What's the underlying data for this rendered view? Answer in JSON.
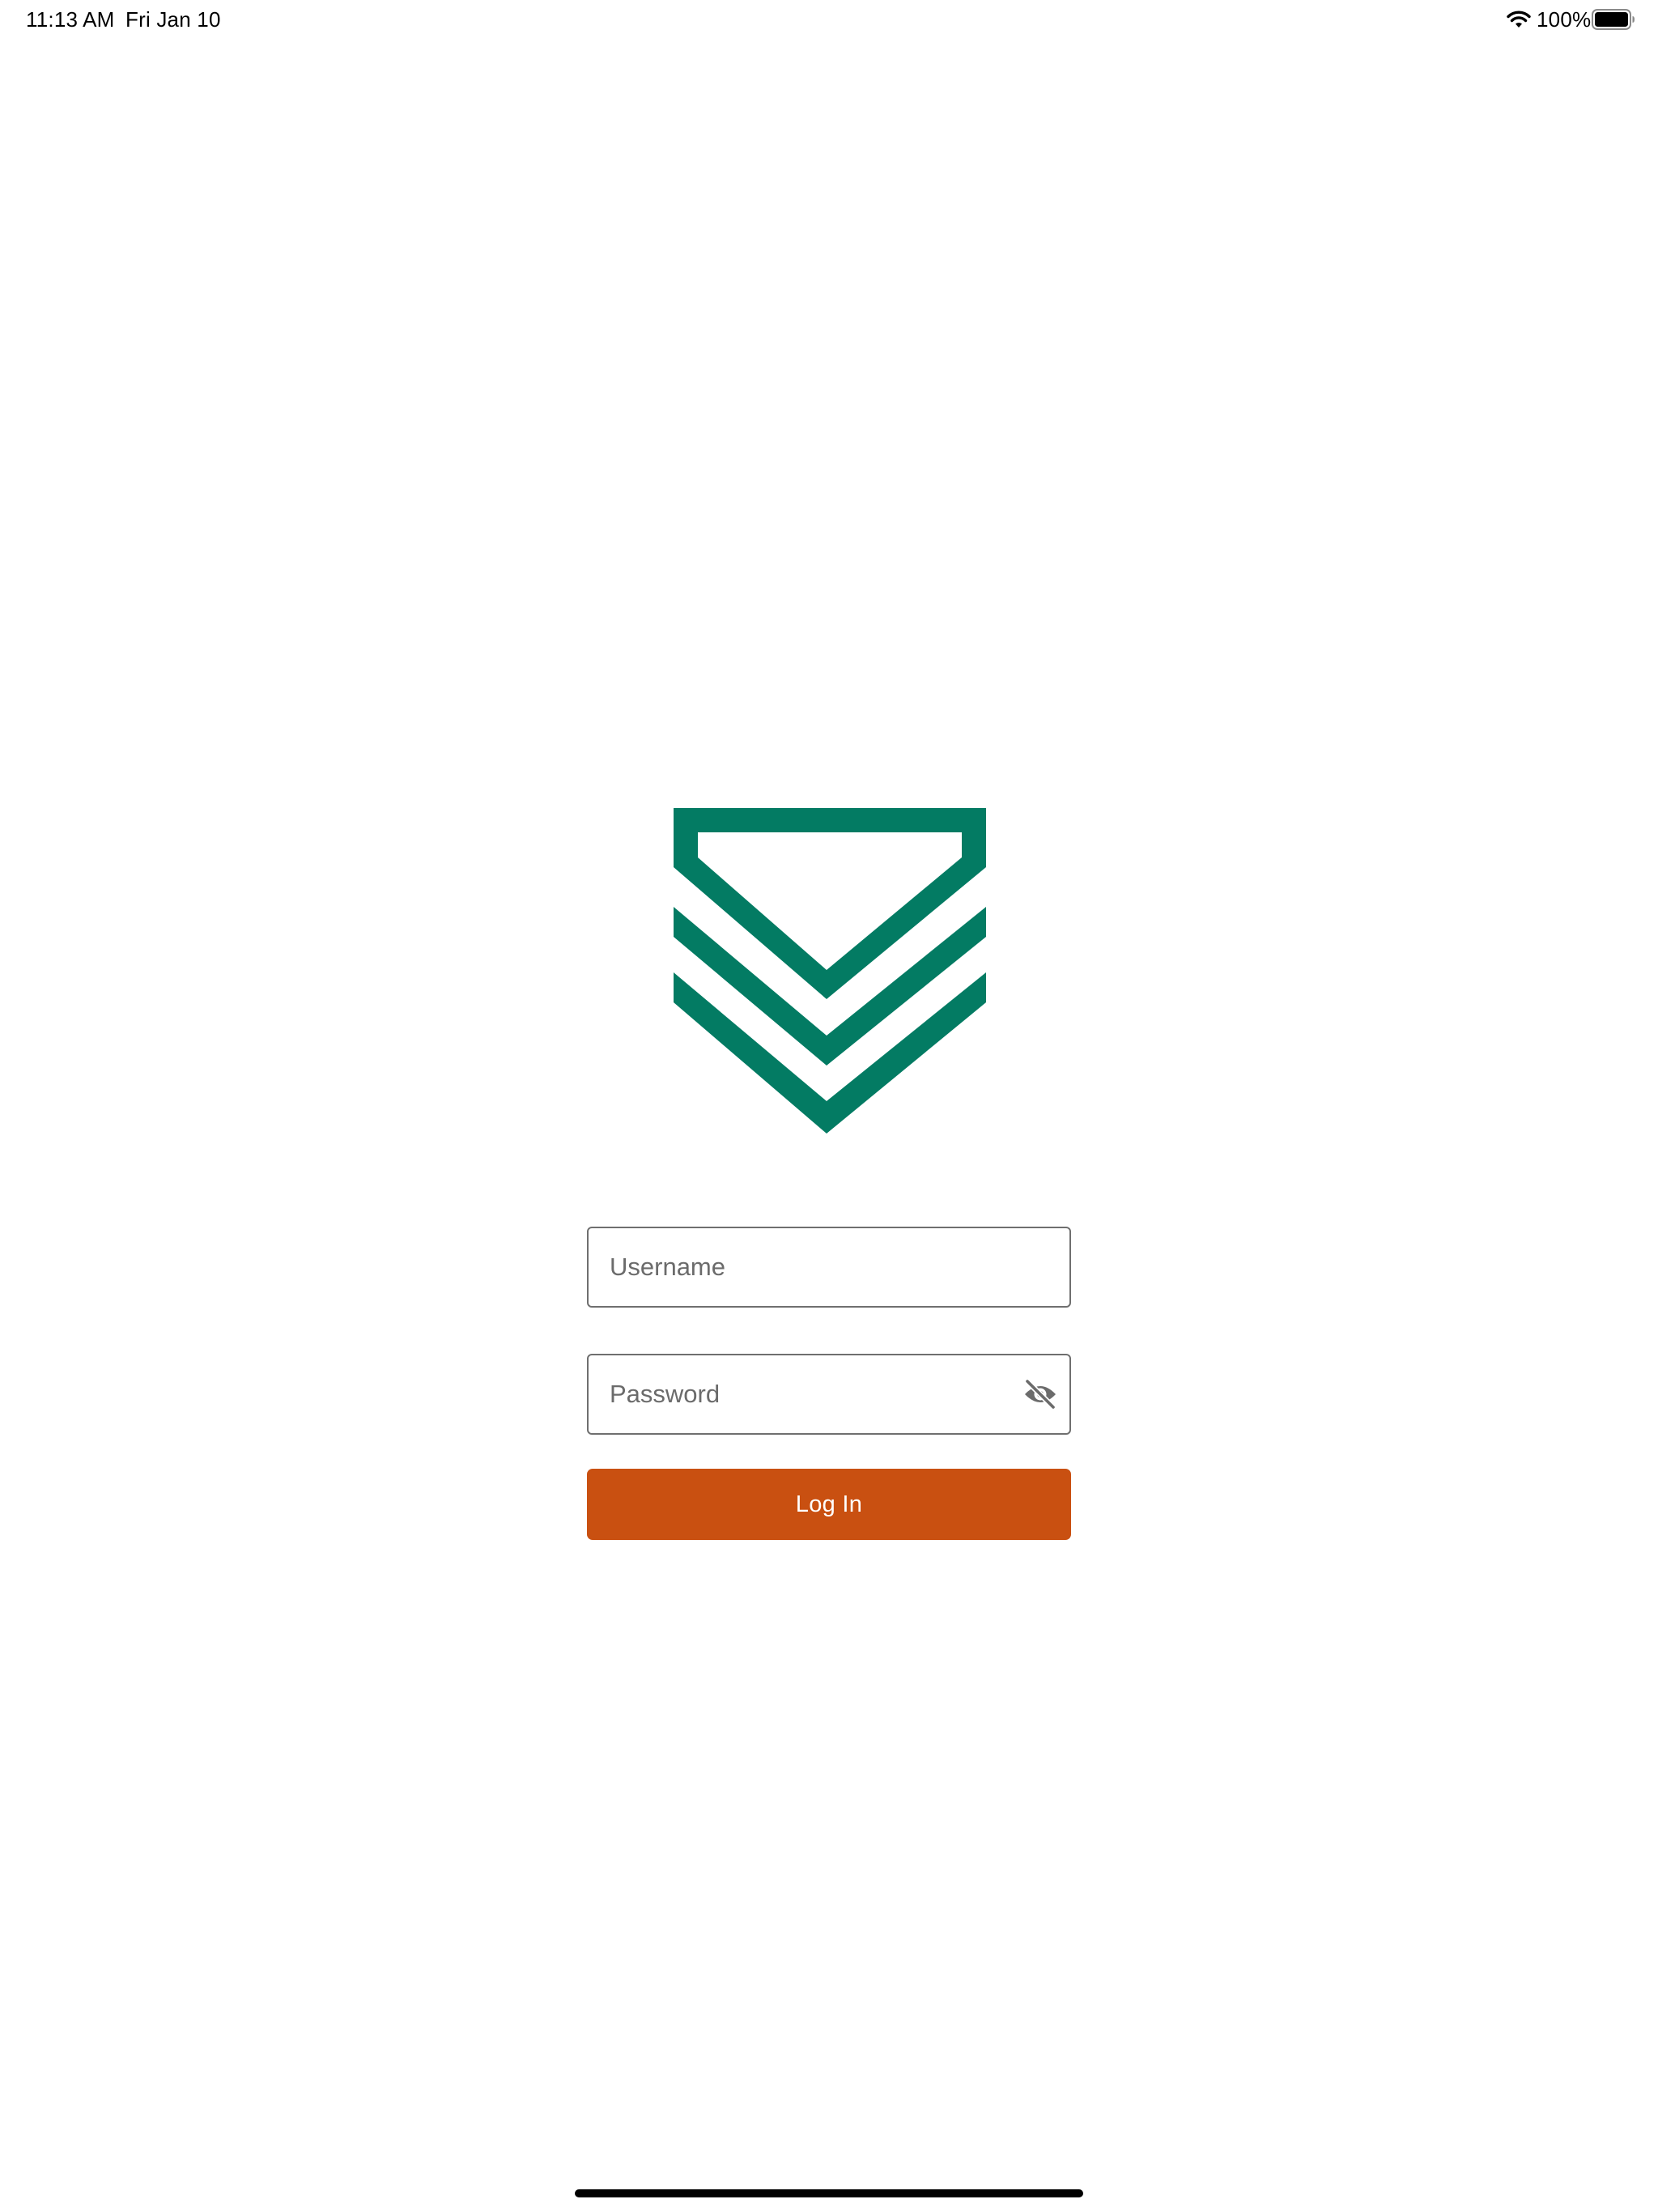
{
  "status_bar": {
    "time": "11:13 AM",
    "date": "Fri Jan 10",
    "battery_percent": "100%",
    "wifi_icon": "wifi-icon",
    "battery_icon": "battery-icon"
  },
  "logo": {
    "icon": "chevron-shield-logo",
    "color": "#037b63"
  },
  "login_form": {
    "username": {
      "value": "",
      "placeholder": "Username"
    },
    "password": {
      "value": "",
      "placeholder": "Password",
      "toggle_icon": "eye-slash-icon"
    },
    "login_label": "Log In",
    "login_color": "#c95011"
  },
  "colors": {
    "background": "#ffffff",
    "field_border": "#6f6f6f",
    "placeholder": "#6b6b6b"
  }
}
